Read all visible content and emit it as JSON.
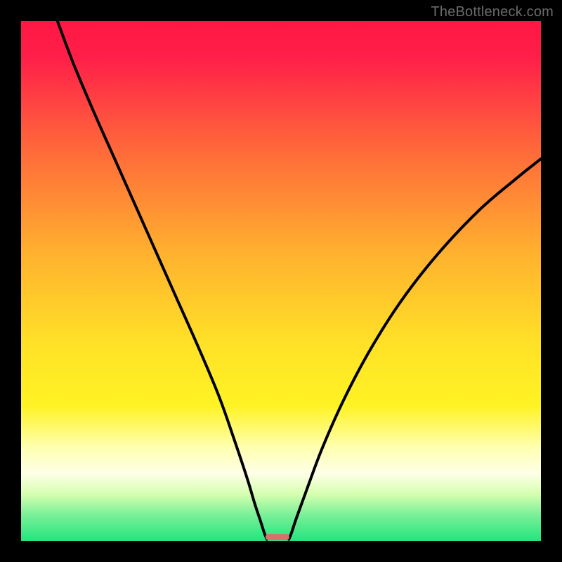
{
  "watermark": "TheBottleneck.com",
  "chart_data": {
    "type": "line",
    "title": "",
    "xlabel": "",
    "ylabel": "",
    "xlim": [
      0,
      100
    ],
    "ylim": [
      0,
      100
    ],
    "gradient_stops": [
      {
        "offset": 0.0,
        "color": "#ff1744"
      },
      {
        "offset": 0.07,
        "color": "#ff1f49"
      },
      {
        "offset": 0.25,
        "color": "#ff6a3a"
      },
      {
        "offset": 0.45,
        "color": "#ffb22e"
      },
      {
        "offset": 0.62,
        "color": "#ffe127"
      },
      {
        "offset": 0.74,
        "color": "#fff324"
      },
      {
        "offset": 0.82,
        "color": "#ffffb0"
      },
      {
        "offset": 0.87,
        "color": "#feffe6"
      },
      {
        "offset": 0.91,
        "color": "#d6ffb0"
      },
      {
        "offset": 0.95,
        "color": "#7af098"
      },
      {
        "offset": 1.0,
        "color": "#23e57e"
      }
    ],
    "series": [
      {
        "name": "left-curve",
        "x": [
          7.0,
          10.0,
          14.0,
          18.0,
          22.0,
          26.0,
          30.0,
          34.0,
          38.0,
          41.0,
          43.5,
          45.0,
          46.0,
          46.8,
          47.3
        ],
        "y": [
          100.0,
          92.0,
          82.5,
          73.5,
          64.5,
          55.5,
          46.5,
          37.5,
          28.0,
          19.5,
          12.0,
          7.0,
          4.0,
          1.5,
          0.3
        ]
      },
      {
        "name": "right-curve",
        "x": [
          51.5,
          52.0,
          53.0,
          55.0,
          58.0,
          62.0,
          67.0,
          73.0,
          80.0,
          88.0,
          95.0,
          100.0
        ],
        "y": [
          0.3,
          1.5,
          4.5,
          10.0,
          18.0,
          27.0,
          36.5,
          46.0,
          55.0,
          63.5,
          69.5,
          73.5
        ]
      }
    ],
    "marker": {
      "x_center": 49.3,
      "width": 4.6,
      "height_pct": 1.2,
      "color": "#d9706c"
    }
  }
}
